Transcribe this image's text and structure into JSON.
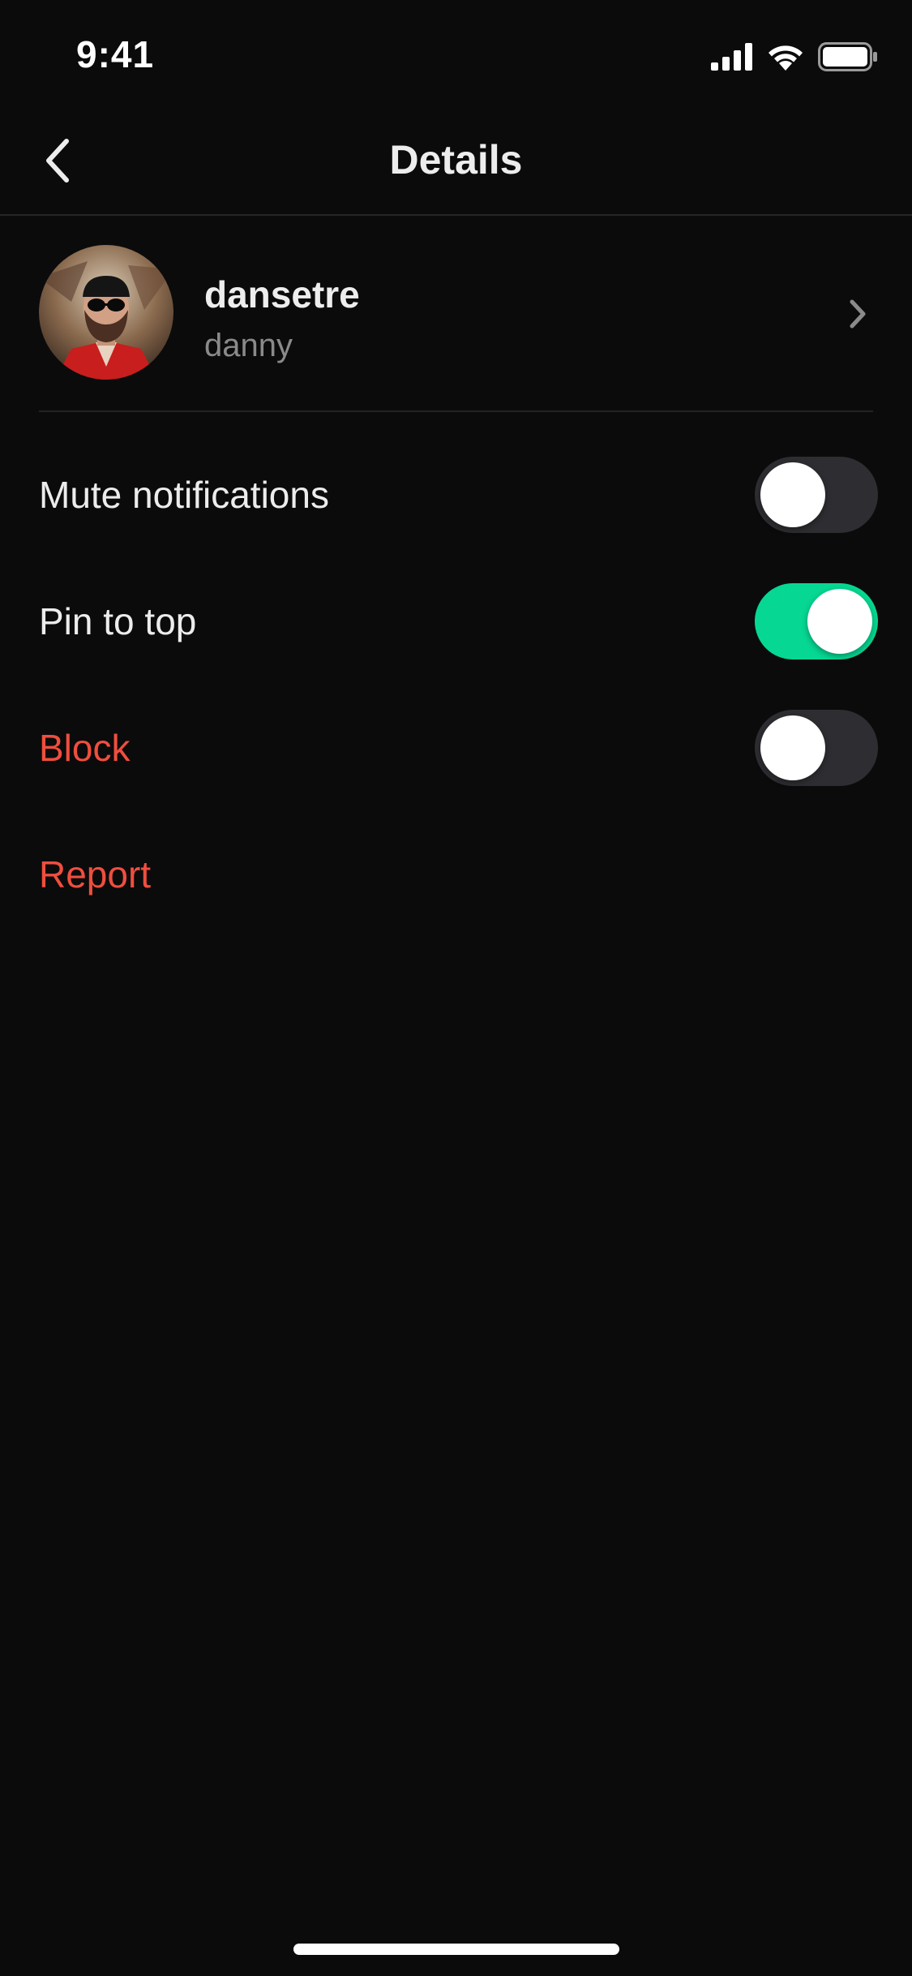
{
  "status_bar": {
    "time": "9:41",
    "icons": [
      "signal-icon",
      "wifi-icon",
      "battery-icon"
    ]
  },
  "nav": {
    "title": "Details",
    "back_icon": "chevron-left-icon"
  },
  "profile": {
    "username": "dansetre",
    "display_name": "danny",
    "chevron_icon": "chevron-right-icon"
  },
  "settings": [
    {
      "label": "Mute notifications",
      "toggle": false,
      "danger": false
    },
    {
      "label": "Pin to top",
      "toggle": true,
      "danger": false
    },
    {
      "label": "Block",
      "toggle": false,
      "danger": true
    },
    {
      "label": "Report",
      "danger": true
    }
  ],
  "colors": {
    "background": "#0b0b0b",
    "toggle_on": "#06d893",
    "toggle_off": "#2e2e32",
    "danger": "#ef4e3e",
    "secondary_text": "#8a8a8a"
  }
}
